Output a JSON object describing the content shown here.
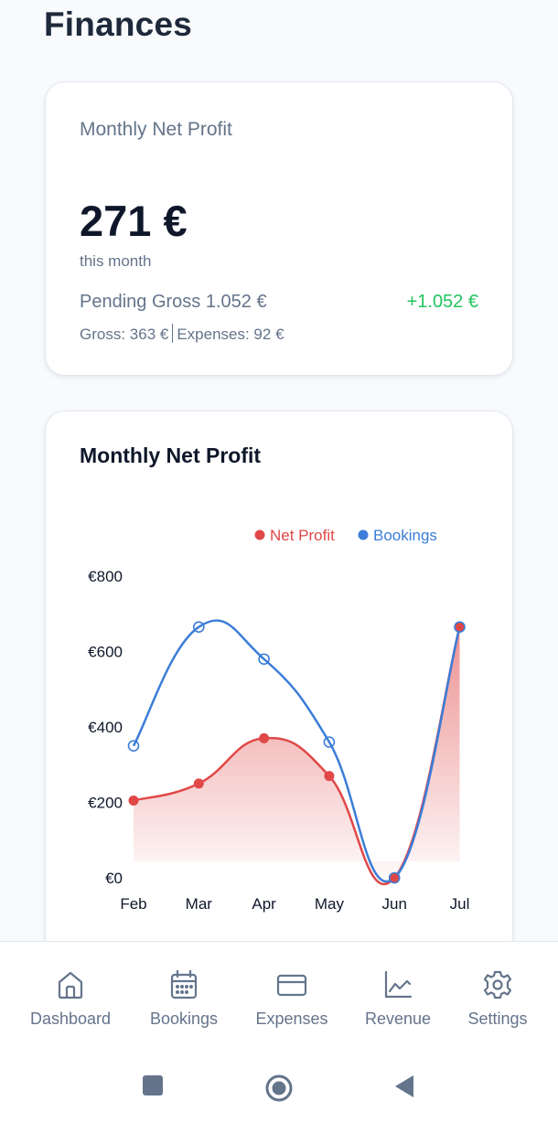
{
  "page": {
    "title": "Finances"
  },
  "summary": {
    "title": "Monthly Net Profit",
    "amount": "271 €",
    "period": "this month",
    "pending": "Pending Gross 1.052 €",
    "delta": "+1.052 €",
    "gross": "Gross: 363 €",
    "expenses": "Expenses: 92 €"
  },
  "chart_card": {
    "title": "Monthly Net Profit"
  },
  "chart_data": {
    "type": "line",
    "title": "Monthly Net Profit",
    "categories": [
      "Feb",
      "Mar",
      "Apr",
      "May",
      "Jun",
      "Jul"
    ],
    "ylim": [
      0,
      800
    ],
    "yticks": [
      0,
      200,
      400,
      600,
      800
    ],
    "ytick_labels": [
      "€0",
      "€200",
      "€400",
      "€600",
      "€800"
    ],
    "legend_position": "top-right",
    "series": [
      {
        "name": "Net Profit",
        "color": "#e04848",
        "fill": true,
        "marker": "filled",
        "values": [
          205,
          250,
          370,
          270,
          0,
          665
        ]
      },
      {
        "name": "Bookings",
        "color": "#3b7dd8",
        "fill": false,
        "marker": "hollow",
        "values": [
          350,
          665,
          580,
          360,
          0,
          665
        ]
      }
    ]
  },
  "nav": {
    "items": [
      {
        "label": "Dashboard",
        "icon": "home-icon"
      },
      {
        "label": "Bookings",
        "icon": "calendar-icon"
      },
      {
        "label": "Expenses",
        "icon": "credit-card-icon"
      },
      {
        "label": "Revenue",
        "icon": "line-chart-icon"
      },
      {
        "label": "Settings",
        "icon": "gear-icon"
      }
    ]
  },
  "system_nav": {
    "icons": [
      "square-icon",
      "circle-icon",
      "back-triangle-icon"
    ]
  }
}
